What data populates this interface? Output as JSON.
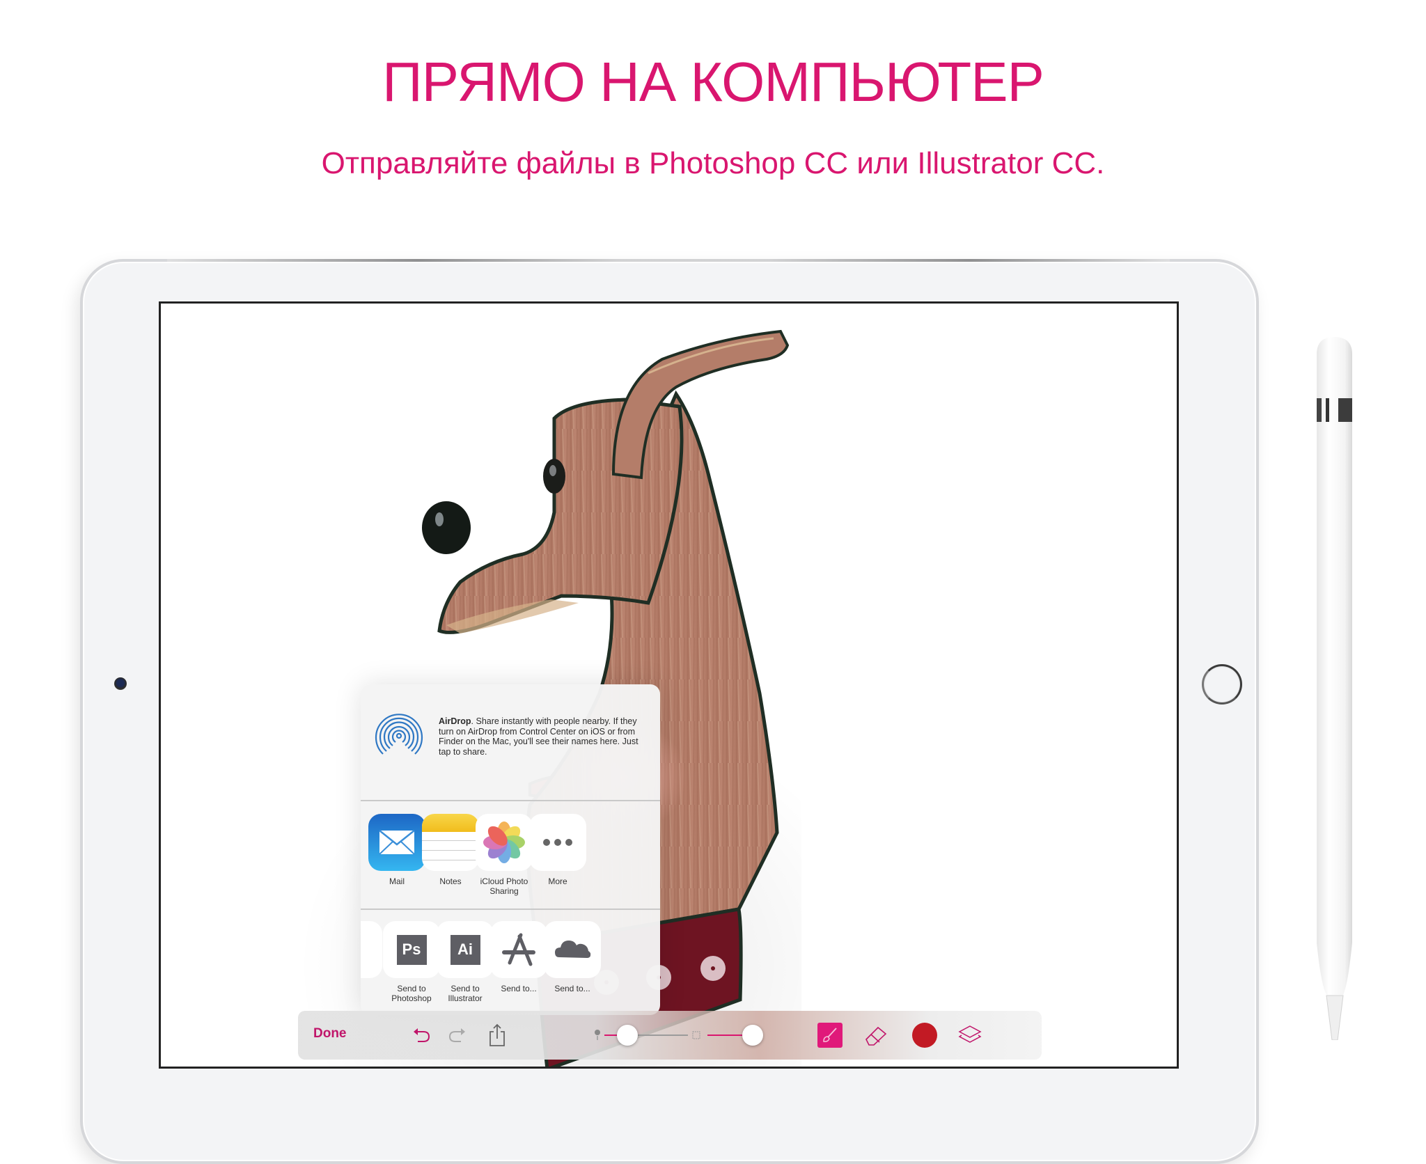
{
  "header": {
    "title": "ПРЯМО НА КОМПЬЮТЕР",
    "subtitle": "Отправляйте файлы в Photoshop CC или Illustrator CC."
  },
  "colors": {
    "accent": "#D9166F",
    "brush_color": "#C21A24",
    "dog_fur": "#B57C68",
    "dog_collar": "#6E1422",
    "dog_outline": "#1F2E24"
  },
  "share_sheet": {
    "airdrop": {
      "title": "AirDrop",
      "description": ". Share instantly with people nearby. If they turn on AirDrop from Control Center on iOS or from Finder on the Mac, you'll see their names here. Just tap to share."
    },
    "share_apps": [
      {
        "label": "Mail",
        "icon": "mail-icon"
      },
      {
        "label": "Notes",
        "icon": "notes-icon"
      },
      {
        "label": "iCloud Photo Sharing",
        "icon": "photos-icon"
      },
      {
        "label": "More",
        "icon": "more-icon"
      }
    ],
    "actions": [
      {
        "label": "Send to Photoshop",
        "icon": "photoshop-icon",
        "glyph": "Ps"
      },
      {
        "label": "Send to Illustrator",
        "icon": "illustrator-icon",
        "glyph": "Ai"
      },
      {
        "label": "Send to...",
        "icon": "app-store-icon"
      },
      {
        "label": "Send to...",
        "icon": "cloud-icon"
      }
    ]
  },
  "toolbar": {
    "done_label": "Done",
    "brush_size": 0.2,
    "opacity": 0.9,
    "active_tool": "brush"
  }
}
